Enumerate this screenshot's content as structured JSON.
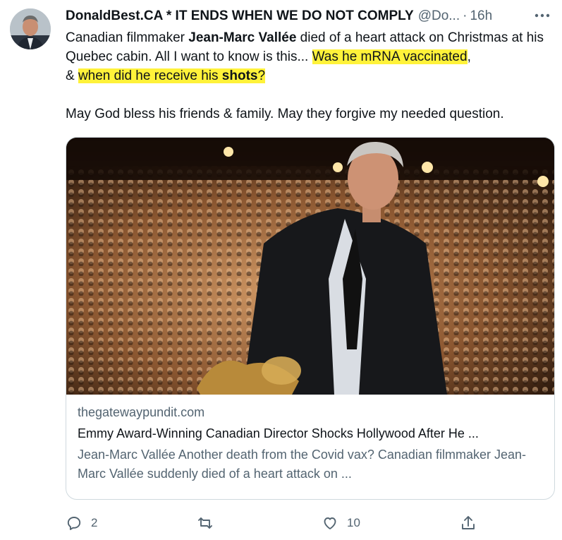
{
  "tweet": {
    "author_name": "DonaldBest.CA * IT ENDS WHEN WE DO NOT COMPLY",
    "handle": "@Do...",
    "separator": "·",
    "time": "16h",
    "text": {
      "line1_pre": "Canadian filmmaker ",
      "line1_bold": "Jean-Marc Vallée",
      "line1_post": " died of a heart attack on Christmas at his Quebec cabin. All I want to know is this... ",
      "highlight1": "Was he mRNA vaccinated",
      "comma": ",",
      "amp": "& ",
      "highlight2_pre": "when did he receive his ",
      "highlight2_bold": "shots",
      "highlight2_post": "?",
      "paragraph2": "May God bless his friends & family. May they forgive my needed question."
    }
  },
  "card": {
    "domain": "thegatewaypundit.com",
    "title": "Emmy Award-Winning Canadian Director Shocks Hollywood After He ...",
    "description": "Jean-Marc Vallée Another death from the Covid vax? Canadian filmmaker Jean-Marc Vallée suddenly died of a heart attack on ..."
  },
  "actions": {
    "reply_count": "2",
    "retweet_count": "",
    "like_count": "10"
  },
  "icons": [
    "more-icon",
    "reply-icon",
    "retweet-icon",
    "like-icon",
    "share-icon"
  ],
  "colors": {
    "text": "#0f1419",
    "secondary": "#536471",
    "highlight": "#fff23a",
    "border": "#cfd9de"
  }
}
